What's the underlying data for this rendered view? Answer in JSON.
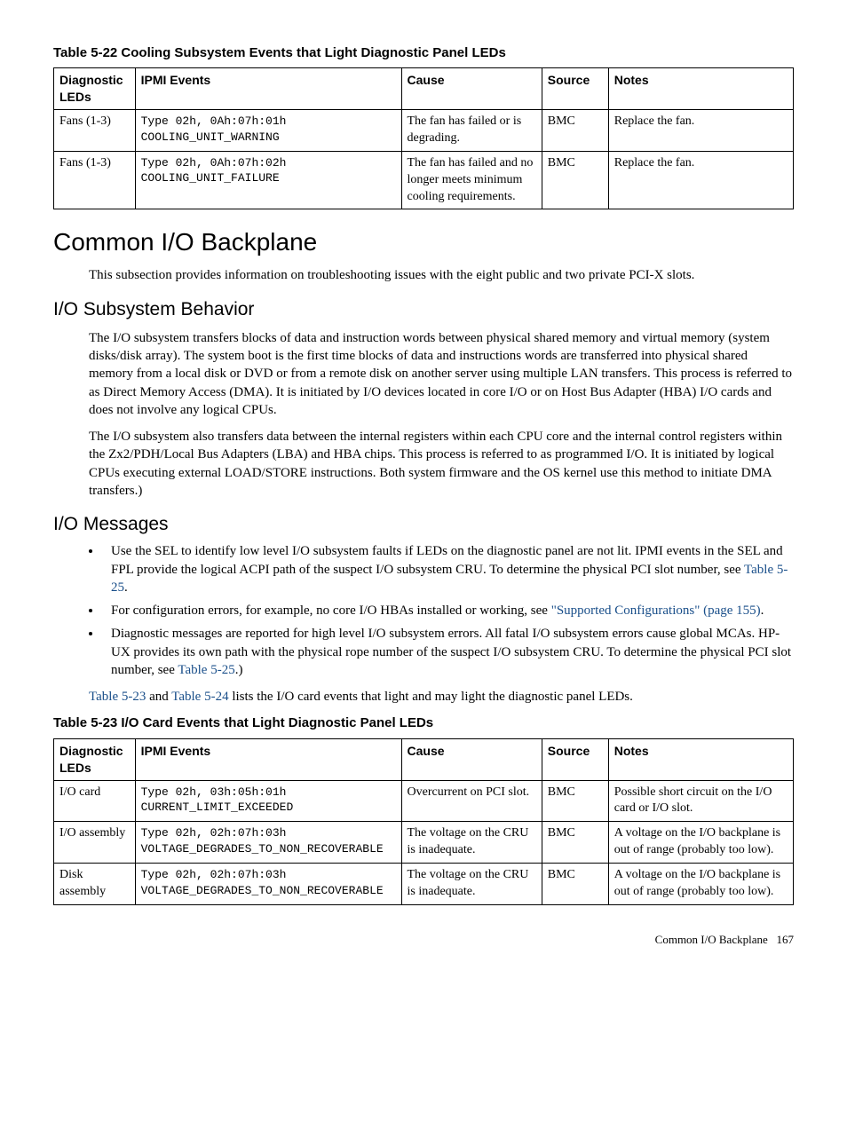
{
  "table22": {
    "caption": "Table 5-22 Cooling Subsystem Events that Light Diagnostic Panel LEDs",
    "headers": {
      "c1": "Diagnostic LEDs",
      "c2": "IPMI Events",
      "c3": "Cause",
      "c4": "Source",
      "c5": "Notes"
    },
    "rows": [
      {
        "c1": "Fans (1-3)",
        "c2": "Type 02h, 0Ah:07h:01h COOLING_UNIT_WARNING",
        "c3": "The fan has failed or is degrading.",
        "c4": "BMC",
        "c5": "Replace the fan."
      },
      {
        "c1": "Fans (1-3)",
        "c2": "Type 02h, 0Ah:07h:02h COOLING_UNIT_FAILURE",
        "c3": "The fan has failed and no longer meets minimum cooling requirements.",
        "c4": "BMC",
        "c5": "Replace the fan."
      }
    ]
  },
  "s1": {
    "heading": "Common I/O Backplane",
    "p1": "This subsection provides information on troubleshooting issues with the eight public and two private PCI-X slots."
  },
  "s2": {
    "heading": "I/O Subsystem Behavior",
    "p1": "The I/O subsystem transfers blocks of data and instruction words between physical shared memory and virtual memory (system disks/disk array). The system boot is the first time blocks of data and instructions words are transferred into physical shared memory from a local disk or DVD or from a remote disk on another server using multiple LAN transfers. This process is referred to as Direct Memory Access (DMA). It is initiated by I/O devices located in core I/O or on Host Bus Adapter (HBA) I/O cards and does not involve any logical CPUs.",
    "p2": "The I/O subsystem also transfers data between the internal registers within each CPU core and the internal control registers within the Zx2/PDH/Local Bus Adapters (LBA) and HBA chips. This process is referred to as programmed I/O. It is initiated by logical CPUs executing external LOAD/STORE instructions. Both system firmware and the OS kernel use this method to initiate DMA transfers.)"
  },
  "s3": {
    "heading": "I/O Messages",
    "b1a": "Use the SEL to identify low level I/O subsystem faults if LEDs on the diagnostic panel are not lit. IPMI events in the SEL and FPL provide the logical ACPI path of the suspect I/O subsystem CRU. To determine the physical PCI slot number, see ",
    "b1link": "Table 5-25",
    "b1b": ".",
    "b2a": "For configuration errors, for example, no core I/O HBAs installed or working, see ",
    "b2link": "\"Supported Configurations\" (page 155)",
    "b2b": ".",
    "b3a": "Diagnostic messages are reported for high level I/O subsystem errors. All fatal I/O subsystem errors cause global MCAs. HP-UX provides its own path with the physical rope number of the suspect I/O subsystem CRU. To determine the physical PCI slot number, see ",
    "b3link": "Table 5-25",
    "b3b": ".)",
    "p_after_a": "Table 5-23",
    "p_after_mid": " and ",
    "p_after_b": "Table 5-24",
    "p_after_end": " lists the I/O card events that light and may light the diagnostic panel LEDs."
  },
  "table23": {
    "caption": "Table 5-23 I/O Card Events that Light Diagnostic Panel LEDs",
    "headers": {
      "c1": "Diagnostic LEDs",
      "c2": "IPMI Events",
      "c3": "Cause",
      "c4": "Source",
      "c5": "Notes"
    },
    "rows": [
      {
        "c1": "I/O card",
        "c2": "Type 02h, 03h:05h:01h CURRENT_LIMIT_EXCEEDED",
        "c3": "Overcurrent on PCI slot.",
        "c4": "BMC",
        "c5": "Possible short circuit on the I/O card or I/O slot."
      },
      {
        "c1": "I/O assembly",
        "c2": "Type 02h, 02h:07h:03h VOLTAGE_DEGRADES_TO_NON_RECOVERABLE",
        "c3": "The voltage on the CRU is inadequate.",
        "c4": "BMC",
        "c5": "A voltage on the I/O backplane is out of range (probably too low)."
      },
      {
        "c1": "Disk assembly",
        "c2": "Type 02h, 02h:07h:03h VOLTAGE_DEGRADES_TO_NON_RECOVERABLE",
        "c3": "The voltage on the CRU is inadequate.",
        "c4": "BMC",
        "c5": "A voltage on the I/O backplane is out of range (probably too low)."
      }
    ]
  },
  "footer": {
    "text": "Common I/O Backplane",
    "page": "167"
  }
}
